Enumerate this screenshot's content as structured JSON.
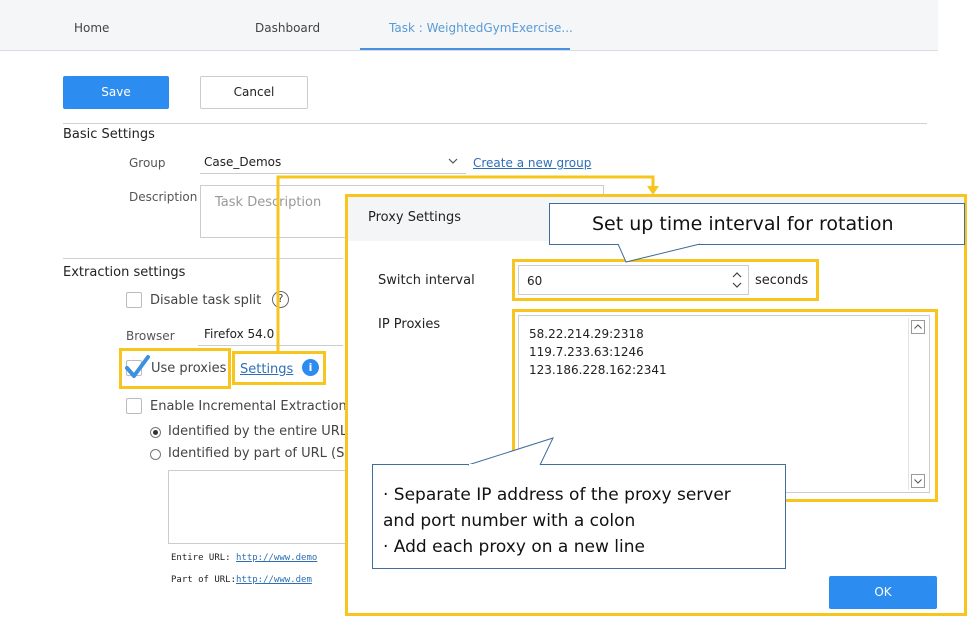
{
  "tabs": {
    "home": "Home",
    "dashboard": "Dashboard",
    "task": "Task : WeightedGymExercise..."
  },
  "toolbar": {
    "save_label": "Save",
    "cancel_label": "Cancel"
  },
  "basic_settings": {
    "title": "Basic Settings",
    "group_label": "Group",
    "group_value": "Case_Demos",
    "create_group_link": "Create a new group",
    "description_label": "Description",
    "description_placeholder": "Task Description"
  },
  "extraction": {
    "title": "Extraction settings",
    "disable_split_label": "Disable task split",
    "help_glyph": "?",
    "browser_label": "Browser",
    "browser_value": "Firefox 54.0",
    "use_proxies_label": "Use proxies",
    "use_proxies_checked": true,
    "settings_link": "Settings",
    "info_glyph": "i",
    "incremental_label": "Enable Incremental Extraction",
    "radio_entire": "Identified by the entire URL",
    "radio_part": "Identified by part of URL (S",
    "entire_url_label": "Entire URL:",
    "entire_url_value": "http://www.demo",
    "part_url_label": "Part of URL:",
    "part_url_value": "http://www.dem"
  },
  "proxy_dialog": {
    "title": "Proxy Settings",
    "switch_interval_label": "Switch interval",
    "switch_interval_value": "60",
    "unit_label": "seconds",
    "ip_proxies_label": "IP Proxies",
    "proxies": [
      "58.22.214.29:2318",
      "119.7.233.63:1246",
      "123.186.228.162:2341"
    ],
    "ok_label": "OK"
  },
  "callouts": {
    "interval": "Set up time interval for rotation",
    "proxies_line1": "· Separate IP address of the proxy server",
    "proxies_line2": "and port number with a colon",
    "proxies_line3": "· Add each proxy on a new line"
  },
  "colors": {
    "accent": "#2d8cf0",
    "highlight": "#f7c51e",
    "link": "#2d6fb7"
  }
}
